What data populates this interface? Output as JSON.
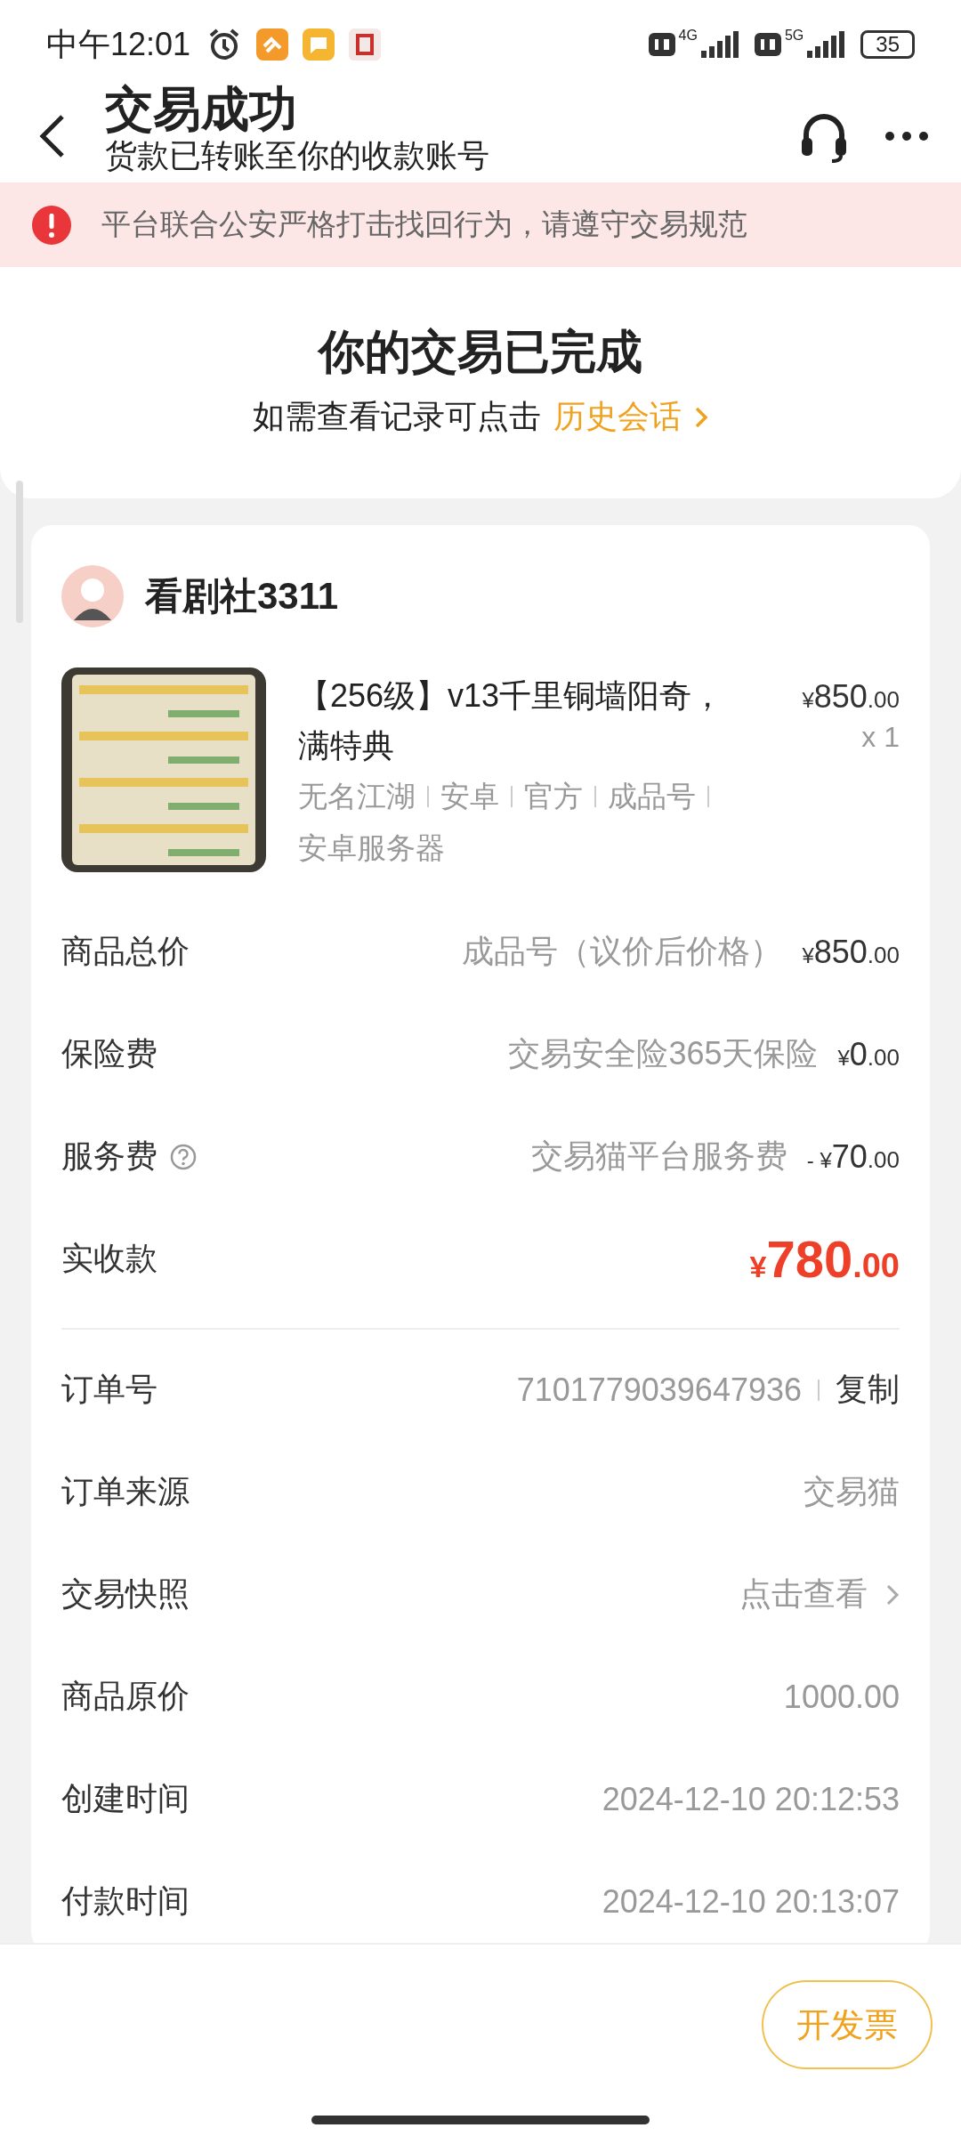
{
  "status_bar": {
    "time": "中午12:01",
    "network_1": "4G",
    "network_2": "5G",
    "battery": "35"
  },
  "header": {
    "title": "交易成功",
    "subtitle": "货款已转账至你的收款账号"
  },
  "alert": {
    "text": "平台联合公安严格打击找回行为，请遵守交易规范"
  },
  "completion": {
    "title": "你的交易已完成",
    "hint": "如需查看记录可点击",
    "link": "历史会话"
  },
  "seller": {
    "name": "看剧社3311"
  },
  "product": {
    "kind": "picture",
    "title": "【256级】v13千里铜墙阳奇，满特典",
    "tags": [
      "无名江湖",
      "安卓",
      "官方",
      "成品号",
      "安卓服务器"
    ],
    "price": {
      "symbol": "¥",
      "main": "850",
      "cents": ".00"
    },
    "quantity": "x 1"
  },
  "price_rows": [
    {
      "kind": "fee",
      "label": "商品总价",
      "help": false,
      "note": "成品号（议价后价格）",
      "price": {
        "symbol": "¥",
        "main": "850",
        "cents": ".00"
      }
    },
    {
      "kind": "fee",
      "label": "保险费",
      "help": false,
      "note": "交易安全险365天保险",
      "price": {
        "symbol": "¥",
        "main": "0",
        "cents": ".00"
      }
    },
    {
      "kind": "fee",
      "label": "服务费",
      "help": true,
      "note": "交易猫平台服务费",
      "price": {
        "sign": "-",
        "symbol": "¥",
        "main": "70",
        "cents": ".00"
      }
    },
    {
      "kind": "total",
      "label": "实收款",
      "help": false,
      "price": {
        "symbol": "¥",
        "main": "780",
        "cents": ".00"
      }
    }
  ],
  "order_rows": [
    {
      "kind": "copy",
      "label": "订单号",
      "value": "7101779039647936",
      "action": "复制"
    },
    {
      "kind": "plain",
      "label": "订单来源",
      "value": "交易猫"
    },
    {
      "kind": "link",
      "label": "交易快照",
      "value": "点击查看"
    },
    {
      "kind": "plain",
      "label": "商品原价",
      "value": "1000.00"
    },
    {
      "kind": "plain",
      "label": "创建时间",
      "value": "2024-12-10 20:12:53"
    },
    {
      "kind": "plain",
      "label": "付款时间",
      "value": "2024-12-10 20:13:07"
    }
  ],
  "bottom_bar": {
    "invoice_button": "开发票"
  }
}
